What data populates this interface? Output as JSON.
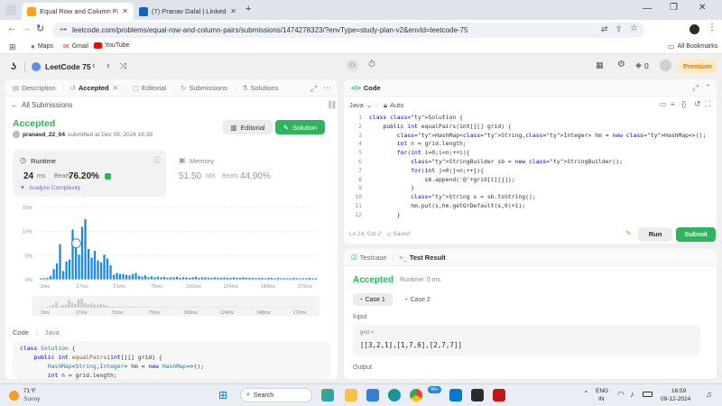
{
  "browser": {
    "tabs": [
      {
        "title": "Equal Row and Column Pairs - L",
        "active": true
      },
      {
        "title": "(7) Pranav Dalal | LinkedIn",
        "active": false
      }
    ],
    "url": "leetcode.com/problems/equal-row-and-column-pairs/submissions/1474278323/?envType=study-plan-v2&envId=leetcode-75",
    "bookmarks": [
      "Maps",
      "Gmail",
      "YouTube"
    ],
    "all_bookmarks": "All Bookmarks"
  },
  "topbar": {
    "study_plan": "LeetCode 75",
    "streak": "0",
    "premium": "Premium"
  },
  "left_tabs": [
    "Description",
    "Accepted",
    "Editorial",
    "Submissions",
    "Solutions"
  ],
  "submission": {
    "back": "All Submissions",
    "status": "Accepted",
    "user": "pranavd_22_04",
    "submitted_text": "submitted at Dec 09, 2024 16:39",
    "editorial_btn": "Editorial",
    "solution_btn": "Solution",
    "runtime_label": "Runtime",
    "runtime_value": "24",
    "runtime_unit": "ms",
    "beats_label": "Beats",
    "runtime_beats": "76.20%",
    "analyze": "Analyze Complexity",
    "memory_label": "Memory",
    "memory_value": "51.50",
    "memory_unit": "MB",
    "memory_beats": "44.90%"
  },
  "chart_data": {
    "type": "bar",
    "y_ticks": [
      "15%",
      "10%",
      "5%",
      "0%"
    ],
    "ylim": [
      0,
      15
    ],
    "x_ticks": [
      "3ms",
      "27ms",
      "51ms",
      "75ms",
      "100ms",
      "124ms",
      "148ms",
      "172ms"
    ],
    "marker_bar_index": 11,
    "values": [
      0.3,
      0.3,
      0.4,
      0.8,
      2.2,
      3.4,
      7.4,
      1.8,
      3.8,
      4.2,
      10.4,
      6.8,
      5.2,
      11.0,
      12.6,
      6.4,
      4.6,
      6.0,
      4.0,
      3.6,
      5.2,
      4.4,
      3.0,
      1.0,
      1.4,
      1.2,
      1.2,
      1.0,
      0.9,
      1.2,
      1.4,
      0.8,
      0.6,
      0.9,
      0.5,
      0.7,
      0.5,
      0.6,
      0.5,
      0.6,
      0.4,
      0.5,
      0.5,
      0.6,
      0.4,
      0.5,
      0.5,
      0.4,
      0.5,
      0.6,
      0.4,
      0.5,
      0.5,
      0.4,
      0.4,
      0.5,
      0.4,
      0.4,
      0.5,
      0.4,
      0.4,
      0.5,
      0.4,
      0.4,
      0.5,
      0.4,
      0.4,
      0.4,
      0.3,
      0.4,
      0.4,
      0.3,
      0.4,
      0.4,
      0.3,
      0.4,
      0.3,
      0.3,
      0.3,
      0.3,
      0.4,
      0.3,
      0.3,
      0.3,
      0.3,
      0.4,
      0.3,
      0.3
    ]
  },
  "left_code": {
    "tab_code": "Code",
    "lang": "Java",
    "lines": [
      "class Solution {",
      "    public int equalPairs(int[][] grid) {",
      "        HashMap<String,Integer> hm = new HashMap<>();",
      "        int n = grid.length;"
    ]
  },
  "code_panel": {
    "title": "Code",
    "lang": "Java",
    "auto": "Auto",
    "line_numbers": [
      "1",
      "2",
      "3",
      "4",
      "5",
      "6",
      "7",
      "8",
      "9",
      "10",
      "11",
      "12",
      "13"
    ],
    "lines": [
      "class Solution {",
      "    public int equalPairs(int[][] grid) {",
      "        HashMap<String,Integer> hm = new HashMap<>();",
      "        int n = grid.length;",
      "        for(int i=0;i<n;++i){",
      "            StringBuilder sb = new StringBuilder();",
      "            for(int j=0;j<n;++j){",
      "                sb.append('@'+grid[i][j]);",
      "            }",
      "            String s = sb.toString();",
      "            hm.put(s,hm.getOrDefault(s,0)+1);",
      "        }",
      "        int ans=0;"
    ],
    "status": "Ln 24, Col 2",
    "saved": "Saved",
    "run": "Run",
    "submit": "Submit"
  },
  "test_panel": {
    "tab_testcase": "Testcase",
    "tab_result": "Test Result",
    "result": "Accepted",
    "runtime": "Runtime: 0 ms",
    "case1": "Case 1",
    "case2": "Case 2",
    "input_label": "Input",
    "var_name": "grid =",
    "grid_value": "[[3,2,1],[1,7,6],[2,7,7]]",
    "output_label": "Output"
  },
  "taskbar": {
    "temp": "71°F",
    "weather": "Sunny",
    "search": "Search",
    "badge": "99+",
    "lang1": "ENG",
    "lang2": "IN",
    "time": "16:59",
    "date": "09-12-2024"
  },
  "colors": {
    "accent_green": "#2db55d",
    "bar_blue": "#1e88e5",
    "premium": "#ffa116"
  }
}
